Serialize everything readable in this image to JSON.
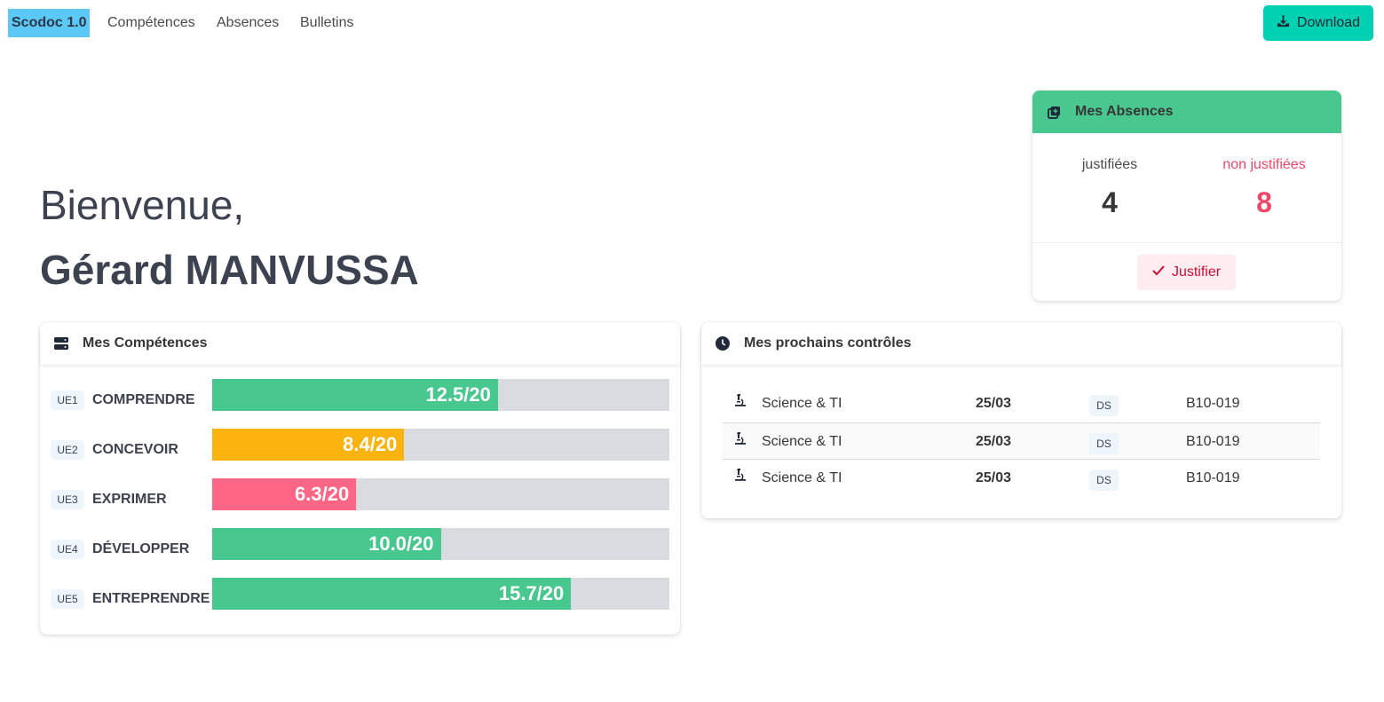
{
  "navbar": {
    "brand": "Scodoc 1.0",
    "links": [
      "Compétences",
      "Absences",
      "Bulletins"
    ],
    "download_label": "Download",
    "download_color": "#00d1b2"
  },
  "welcome": {
    "greeting": "Bienvenue,",
    "student_name": "Gérard MANVUSSA"
  },
  "absences": {
    "title": "Mes Absences",
    "header_color": "#48c78e",
    "justified_label": "justifiées",
    "justified_count": "4",
    "unjustified_label": "non justifiées",
    "unjustified_count": "8",
    "justify_button": "Justifier"
  },
  "competences": {
    "title": "Mes Compétences",
    "items": [
      {
        "code": "UE1",
        "name": "COMPRENDRE",
        "score": 12.5,
        "display": "12.5/20",
        "color": "#48c78e"
      },
      {
        "code": "UE2",
        "name": "CONCEVOIR",
        "score": 8.4,
        "display": "8.4/20",
        "color": "#fbb40f"
      },
      {
        "code": "UE3",
        "name": "EXPRIMER",
        "score": 6.3,
        "display": "6.3/20",
        "color": "#ff6584"
      },
      {
        "code": "UE4",
        "name": "DÉVELOPPER",
        "score": 10.0,
        "display": "10.0/20",
        "color": "#48c78e"
      },
      {
        "code": "UE5",
        "name": "ENTREPRENDRE",
        "score": 15.7,
        "display": "15.7/20",
        "color": "#48c78e"
      }
    ],
    "max_score": 20
  },
  "controles": {
    "title": "Mes prochains contrôles",
    "rows": [
      {
        "icon": "microscope-icon",
        "subject": "Science & TI",
        "date": "25/03",
        "type": "DS",
        "room": "B10-019"
      },
      {
        "icon": "microscope-icon",
        "subject": "Science & TI",
        "date": "25/03",
        "type": "DS",
        "room": "B10-019"
      },
      {
        "icon": "microscope-icon",
        "subject": "Science & TI",
        "date": "25/03",
        "type": "DS",
        "room": "B10-019"
      }
    ]
  }
}
